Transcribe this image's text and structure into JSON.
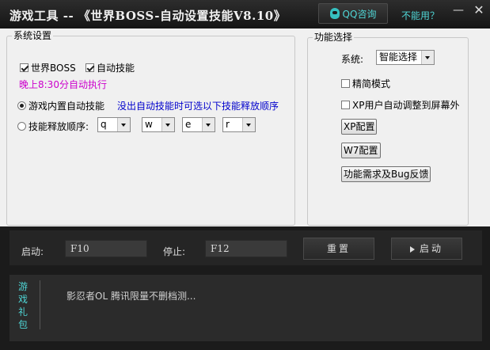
{
  "window": {
    "title": "游戏工具 -- 《世界BOSS-自动设置技能V8.10》",
    "qq_button": "QQ咨询",
    "help_link": "不能用？",
    "minimize": "—",
    "close": "✕"
  },
  "system_settings": {
    "legend": "系统设置",
    "world_boss": {
      "label": "世界BOSS",
      "checked": true
    },
    "auto_skill": {
      "label": "自动技能",
      "checked": true
    },
    "schedule_note": "晚上8:30分自动执行",
    "schedule_color": "#cc00cc",
    "radio_builtin": {
      "label": "游戏内置自动技能",
      "selected": true
    },
    "hint": "没出自动技能时可选以下技能释放顺序",
    "hint_color": "#0000cc",
    "radio_order": {
      "label": "技能释放顺序:",
      "selected": false
    },
    "skill_keys": [
      "q",
      "w",
      "e",
      "r"
    ]
  },
  "features": {
    "legend": "功能选择",
    "system_label": "系统:",
    "system_value": "智能选择",
    "simple_mode": {
      "label": "精简模式",
      "checked": false
    },
    "xp_offscreen": {
      "label": "XP用户自动调整到屏幕外",
      "checked": false
    },
    "xp_config": "XP配置",
    "w7_config": "W7配置",
    "feedback": "功能需求及Bug反馈"
  },
  "hotkeys": {
    "start_label": "启动:",
    "start_key": "F10",
    "stop_label": "停止:",
    "stop_key": "F12",
    "reset_button": "重置",
    "start_button": "启动"
  },
  "info": {
    "gift_label": "游戏礼包",
    "message": "影忍者OL 腾讯限量不删档测..."
  },
  "colors": {
    "accent": "#4fd6d6",
    "dark_bg": "#1b1b1b",
    "panel_bg": "#f0f0f0"
  }
}
